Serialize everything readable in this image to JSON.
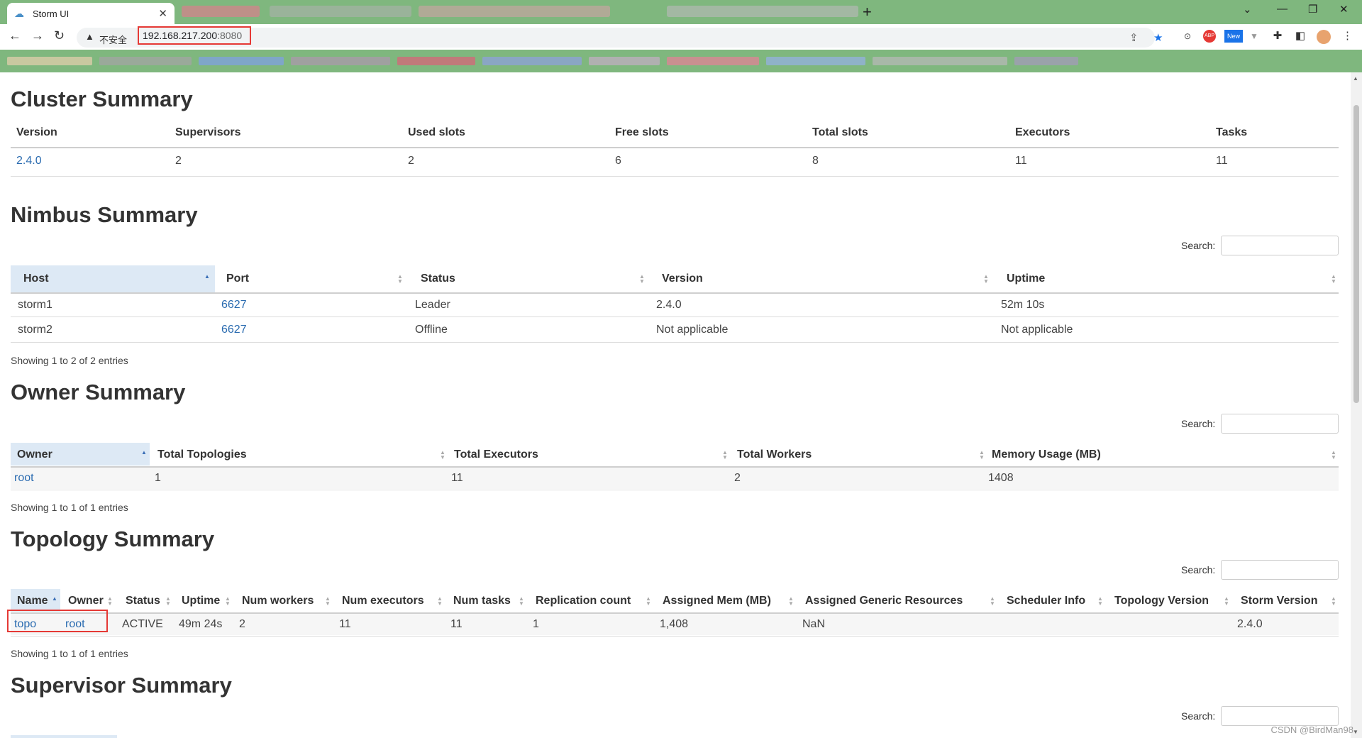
{
  "browser": {
    "tab_title": "Storm UI",
    "insecure_label": "不安全",
    "url_host": "192.168.217.200",
    "url_port": ":8080",
    "new_tab_glyph": "+",
    "ext_abp": "ABP",
    "ext_new": "New",
    "accent_color": "#7fb77e"
  },
  "cluster_summary": {
    "title": "Cluster Summary",
    "headers": [
      "Version",
      "Supervisors",
      "Used slots",
      "Free slots",
      "Total slots",
      "Executors",
      "Tasks"
    ],
    "values": [
      "2.4.0",
      "2",
      "2",
      "6",
      "8",
      "11",
      "11"
    ]
  },
  "nimbus_summary": {
    "title": "Nimbus Summary",
    "search_label": "Search:",
    "headers": [
      "Host",
      "Port",
      "Status",
      "Version",
      "Uptime"
    ],
    "rows": [
      [
        "storm1",
        "6627",
        "Leader",
        "2.4.0",
        "52m 10s"
      ],
      [
        "storm2",
        "6627",
        "Offline",
        "Not applicable",
        "Not applicable"
      ]
    ],
    "info": "Showing 1 to 2 of 2 entries"
  },
  "owner_summary": {
    "title": "Owner Summary",
    "search_label": "Search:",
    "headers": [
      "Owner",
      "Total Topologies",
      "Total Executors",
      "Total Workers",
      "Memory Usage (MB)"
    ],
    "rows": [
      [
        "root",
        "1",
        "11",
        "2",
        "1408"
      ]
    ],
    "info": "Showing 1 to 1 of 1 entries"
  },
  "topology_summary": {
    "title": "Topology Summary",
    "search_label": "Search:",
    "headers": [
      "Name",
      "Owner",
      "Status",
      "Uptime",
      "Num workers",
      "Num executors",
      "Num tasks",
      "Replication count",
      "Assigned Mem (MB)",
      "Assigned Generic Resources",
      "Scheduler Info",
      "Topology Version",
      "Storm Version"
    ],
    "rows": [
      [
        "topo",
        "root",
        "ACTIVE",
        "49m 24s",
        "2",
        "11",
        "11",
        "1",
        "1,408",
        "NaN",
        "",
        "",
        "2.4.0"
      ]
    ],
    "info": "Showing 1 to 1 of 1 entries"
  },
  "supervisor_summary": {
    "title": "Supervisor Summary",
    "search_label": "Search:"
  },
  "watermark": "CSDN @BirdMan98"
}
